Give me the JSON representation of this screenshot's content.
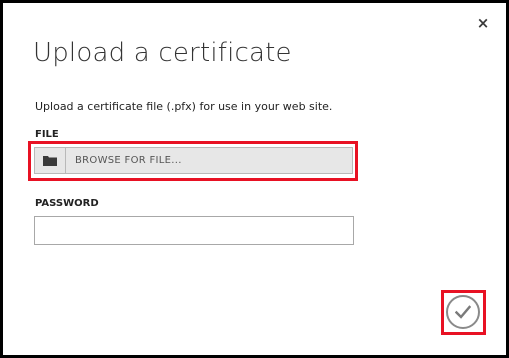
{
  "dialog": {
    "title": "Upload a certificate",
    "description": "Upload a certificate file (.pfx) for use in your web site.",
    "close_symbol": "×"
  },
  "file": {
    "label": "FILE",
    "browse_text": "BROWSE FOR FILE...",
    "icon": "folder-icon"
  },
  "password": {
    "label": "PASSWORD",
    "value": ""
  },
  "confirm": {
    "icon": "checkmark-icon"
  },
  "colors": {
    "highlight": "#e81123",
    "field_bg": "#e7e7e7",
    "title_text": "#333333"
  }
}
